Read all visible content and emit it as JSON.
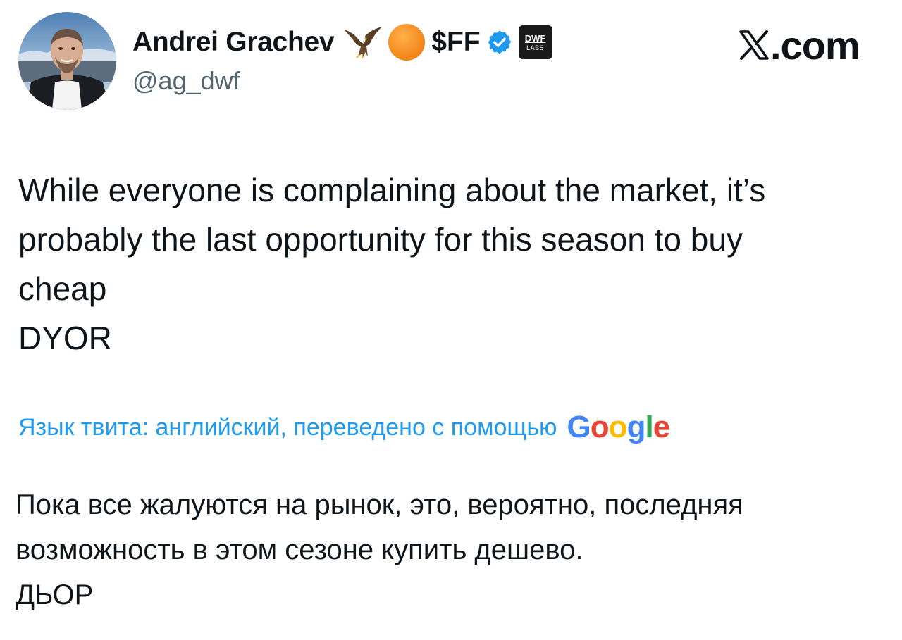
{
  "author": {
    "display_name": "Andrei Grachev",
    "ticker": "$FF",
    "handle": "@ag_dwf",
    "badge_top": "DWF",
    "badge_bottom": "LABS",
    "icons": [
      "avatar-photo",
      "eagle-emoji",
      "orange-circle-emoji",
      "verified-badge-icon",
      "dwf-labs-badge"
    ],
    "verified_color": "#1d9bf0"
  },
  "site": {
    "logo_text": ".com",
    "logo_icon": "x-logo-icon"
  },
  "tweet": {
    "lines": [
      "While everyone is complaining about the market, it’s",
      "probably the last opportunity for this season to buy",
      "cheap",
      "DYOR"
    ]
  },
  "translation": {
    "notice": "Язык твита: английский, переведено с помощью",
    "provider_letters": [
      {
        "char": "G",
        "color": "#4285f4"
      },
      {
        "char": "o",
        "color": "#ea4335"
      },
      {
        "char": "o",
        "color": "#fbbc05"
      },
      {
        "char": "g",
        "color": "#4285f4"
      },
      {
        "char": "l",
        "color": "#34a853"
      },
      {
        "char": "e",
        "color": "#ea4335"
      }
    ],
    "lines": [
      "Пока все жалуются на рынок, это, вероятно, последняя",
      "возможность в этом сезоне купить дешево.",
      "ДЬОР"
    ],
    "link_color": "#1d9bf0"
  }
}
